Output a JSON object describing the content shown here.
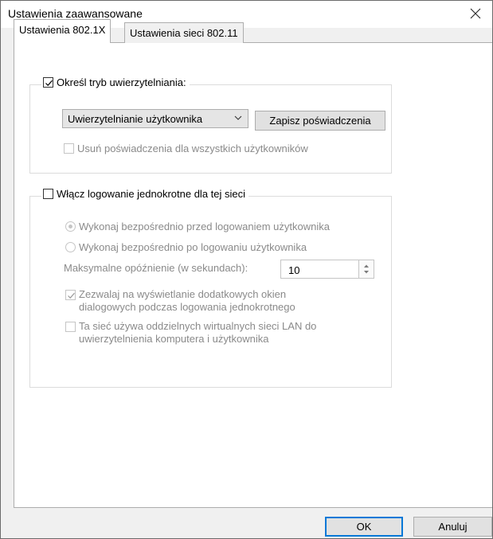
{
  "window": {
    "title": "Ustawienia zaawansowane",
    "close_glyph": "✕"
  },
  "tabs": [
    {
      "label": "Ustawienia 802.1X",
      "active": true
    },
    {
      "label": "Ustawienia sieci 802.11",
      "active": false
    }
  ],
  "auth_group": {
    "checkbox_label": "Określ tryb uwierzytelniania:",
    "checked": true,
    "mode_select": {
      "value": "Uwierzytelnianie użytkownika"
    },
    "save_credentials_label": "Zapisz poświadczenia",
    "delete_credentials_label": "Usuń poświadczenia dla wszystkich użytkowników",
    "delete_credentials_checked": false
  },
  "sso_group": {
    "checkbox_label": "Włącz logowanie jednokrotne dla tej sieci",
    "checked": false,
    "radio_before": "Wykonaj bezpośrednio przed logowaniem użytkownika",
    "radio_after": "Wykonaj bezpośrednio po logowaniu użytkownika",
    "delay_label": "Maksymalne opóźnienie (w sekundach):",
    "delay_value": "10",
    "allow_dialogs_line1": "Zezwalaj na wyświetlanie dodatkowych okien",
    "allow_dialogs_line2": "dialogowych podczas logowania jednokrotnego",
    "allow_dialogs_checked": true,
    "vlan_line1": "Ta sieć używa oddzielnych wirtualnych sieci LAN do",
    "vlan_line2": "uwierzytelnienia komputera i użytkownika",
    "vlan_checked": false
  },
  "footer": {
    "ok_label": "OK",
    "cancel_label": "Anuluj"
  },
  "colors": {
    "dialog_bg": "#f0f0f0",
    "panel_bg": "#ffffff",
    "disabled_text": "#8a8a8a",
    "default_button_border": "#0078d7"
  }
}
